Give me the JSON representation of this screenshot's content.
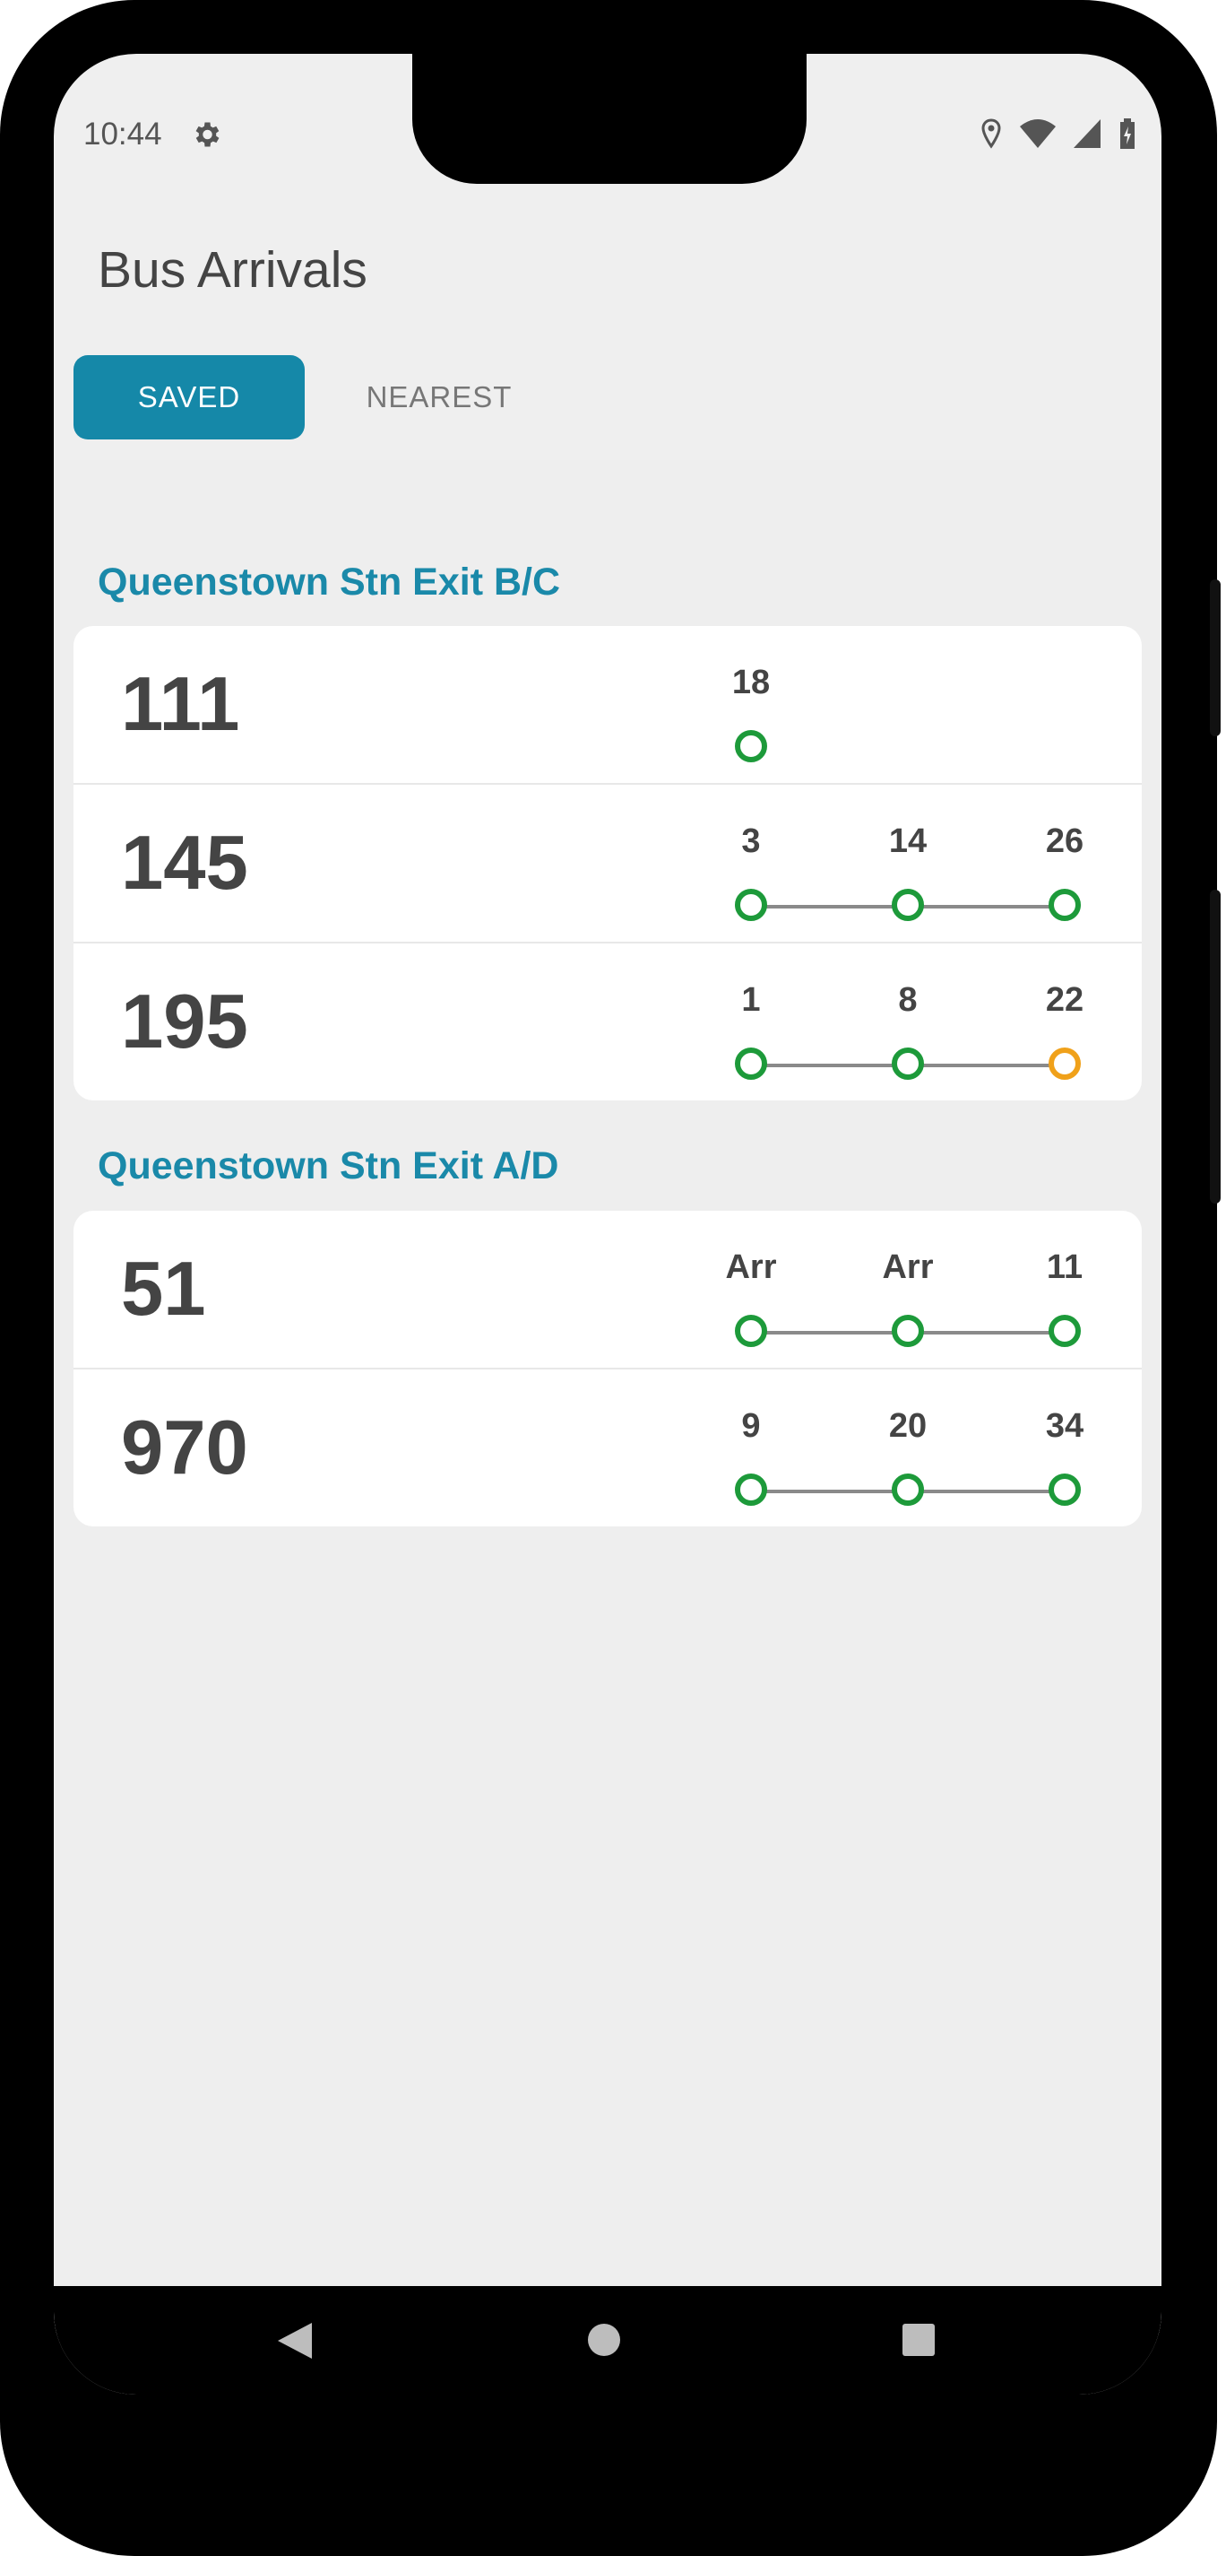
{
  "status": {
    "time": "10:44",
    "icons": [
      "settings-icon",
      "location-icon",
      "wifi-icon",
      "signal-icon",
      "battery-charging-icon"
    ]
  },
  "app": {
    "title": "Bus Arrivals"
  },
  "tabs": {
    "saved": "SAVED",
    "nearest": "NEAREST",
    "active": "saved"
  },
  "stops": [
    {
      "name": "Queenstown Stn Exit B/C",
      "services": [
        {
          "route": "111",
          "arrivals": [
            "18"
          ],
          "load_colors": [
            "#1d9a3a"
          ]
        },
        {
          "route": "145",
          "arrivals": [
            "3",
            "14",
            "26"
          ],
          "load_colors": [
            "#1d9a3a",
            "#1d9a3a",
            "#1d9a3a"
          ]
        },
        {
          "route": "195",
          "arrivals": [
            "1",
            "8",
            "22"
          ],
          "load_colors": [
            "#1d9a3a",
            "#1d9a3a",
            "#f0a11a"
          ]
        }
      ]
    },
    {
      "name": "Queenstown Stn Exit A/D",
      "services": [
        {
          "route": "51",
          "arrivals": [
            "Arr",
            "Arr",
            "11"
          ],
          "load_colors": [
            "#1d9a3a",
            "#1d9a3a",
            "#1d9a3a"
          ]
        },
        {
          "route": "970",
          "arrivals": [
            "9",
            "20",
            "34"
          ],
          "load_colors": [
            "#1d9a3a",
            "#1d9a3a",
            "#1d9a3a"
          ]
        }
      ]
    }
  ],
  "nav": {
    "icons": [
      "back-icon",
      "home-icon",
      "recents-icon"
    ]
  }
}
